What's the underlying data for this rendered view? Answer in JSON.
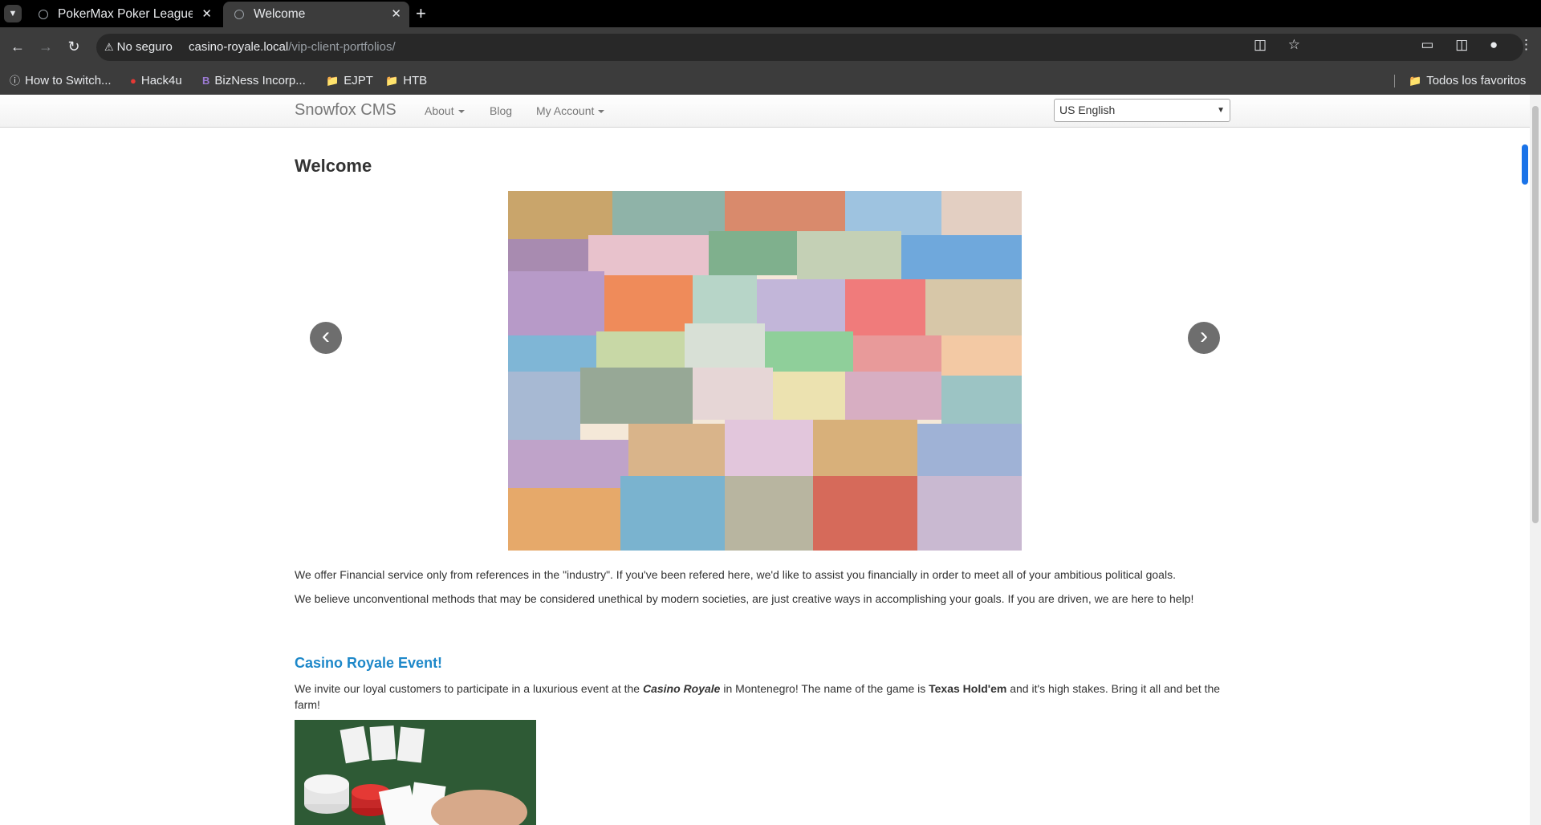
{
  "browser": {
    "tabs": [
      {
        "title": "PokerMax Poker League",
        "active": false
      },
      {
        "title": "Welcome",
        "active": true
      }
    ],
    "security_label": "No seguro",
    "url_host": "casino-royale.local",
    "url_path": "/vip-client-portfolios/",
    "bookmarks": [
      "How to Switch...",
      "Hack4u",
      "BizNess Incorp...",
      "EJPT",
      "HTB"
    ],
    "all_bookmarks": "Todos los favoritos"
  },
  "site": {
    "brand": "Snowfox CMS",
    "nav": [
      "About",
      "Blog",
      "My Account"
    ],
    "language": "US English"
  },
  "page": {
    "title": "Welcome",
    "paragraph1": "We offer Financial service only from references in the \"industry\". If you've been refered here, we'd like to assist you financially in order to meet all of your ambitious political goals.",
    "paragraph2": "We believe unconventional methods that may be considered unethical by modern societies, are just creative ways in accomplishing your goals. If you are driven, we are here to help!",
    "event_title": "Casino Royale Event!",
    "event_text_1": "We invite our loyal customers to participate in a luxurious event at the ",
    "event_em": "Casino Royale",
    "event_text_2": " in Montenegro! The name of the game is ",
    "event_strong": "Texas Hold'em",
    "event_text_3": " and it's high stakes. Bring it all and bet the farm!"
  }
}
